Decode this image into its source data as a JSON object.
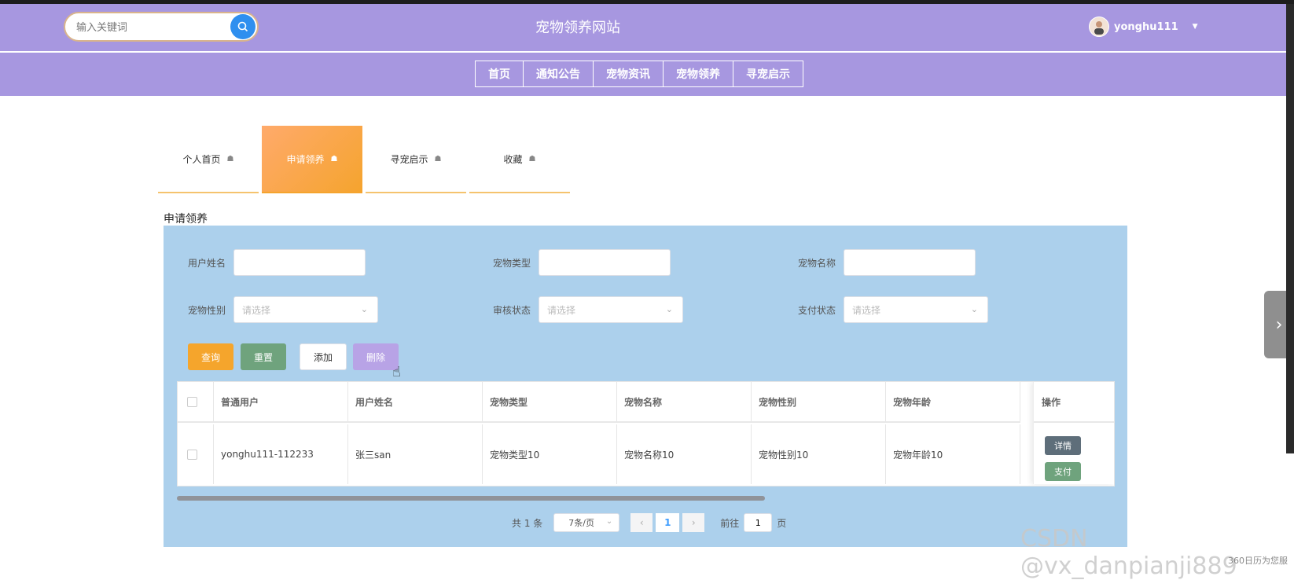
{
  "header": {
    "search_placeholder": "输入关键词",
    "site_title": "宠物领养网站",
    "username": "yonghu111"
  },
  "nav": {
    "items": [
      {
        "label": "首页"
      },
      {
        "label": "通知公告"
      },
      {
        "label": "宠物资讯"
      },
      {
        "label": "宠物领养"
      },
      {
        "label": "寻宠启示"
      }
    ]
  },
  "tabs": [
    {
      "label": "个人首页"
    },
    {
      "label": "申请领养"
    },
    {
      "label": "寻宠启示"
    },
    {
      "label": "收藏"
    }
  ],
  "section_title": "申请领养",
  "filters": {
    "user_name_label": "用户姓名",
    "pet_type_label": "宠物类型",
    "pet_name_label": "宠物名称",
    "pet_gender_label": "宠物性别",
    "audit_label": "审核状态",
    "pay_label": "支付状态",
    "select_placeholder": "请选择"
  },
  "actions": {
    "query": "查询",
    "reset": "重置",
    "add": "添加",
    "delete": "删除"
  },
  "table": {
    "headers": [
      "普通用户",
      "用户姓名",
      "宠物类型",
      "宠物名称",
      "宠物性别",
      "宠物年龄"
    ],
    "ops_header": "操作",
    "rows": [
      {
        "cells": [
          "yonghu111-112233",
          "张三san",
          "宠物类型10",
          "宠物名称10",
          "宠物性别10",
          "宠物年龄10"
        ]
      }
    ],
    "detail_label": "详情",
    "pay_label": "支付"
  },
  "pagination": {
    "total": "共 1 条",
    "page_size": "7条/页",
    "current_page": "1",
    "goto_prefix": "前往",
    "goto_value": "1",
    "goto_suffix": "页"
  },
  "watermark": "CSDN @vx_danpianji889",
  "corner_text": "360日历为您服"
}
